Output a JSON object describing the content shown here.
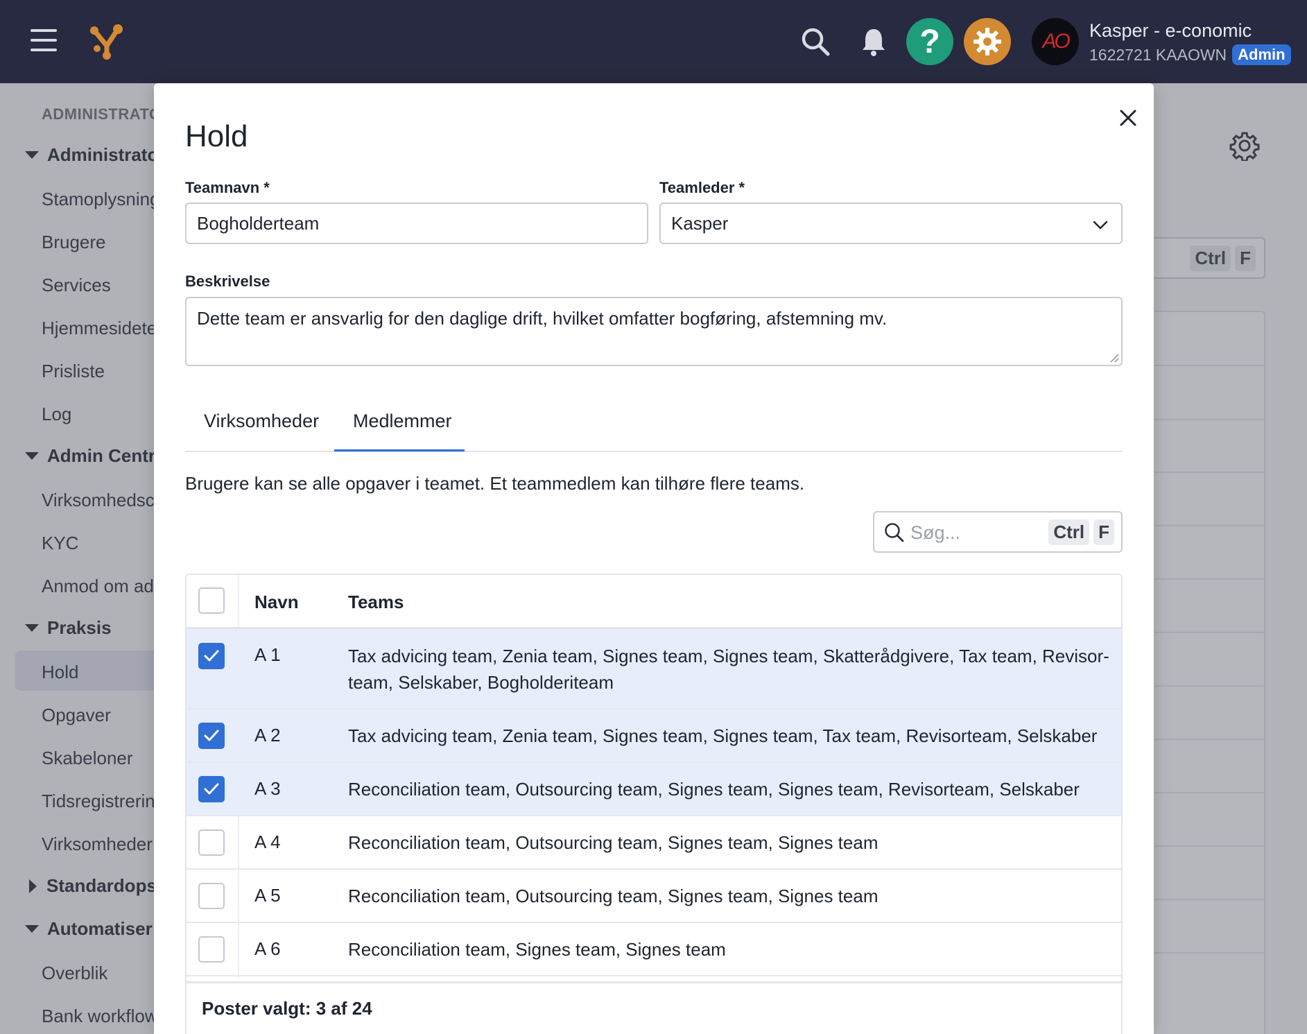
{
  "topbar": {
    "user_name": "Kasper - e-conomic",
    "user_account": "1622721 KAAOWN",
    "role_badge": "Admin",
    "avatar_text": "AO",
    "help_label": "?"
  },
  "sidebar": {
    "section_title": "ADMINISTRATO",
    "groups": [
      {
        "label": "Administrato",
        "items": [
          "Stamoplysning",
          "Brugere",
          "Services",
          "Hjemmesidete",
          "Prisliste",
          "Log"
        ]
      },
      {
        "label": "Admin Centr",
        "items": [
          "Virksomhedsc",
          "KYC",
          "Anmod om ad"
        ]
      },
      {
        "label": "Praksis",
        "items": [
          "Hold",
          "Opgaver",
          "Skabeloner",
          "Tidsregistrerin",
          "Virksomheder"
        ]
      },
      {
        "label": "Standardops",
        "items": []
      },
      {
        "label": "Automatiser",
        "items": [
          "Overblik",
          "Bank workflow"
        ]
      }
    ],
    "active_item": "Hold"
  },
  "background": {
    "kbd_ctrl": "Ctrl",
    "kbd_f": "F"
  },
  "modal": {
    "title": "Hold",
    "teamname_label": "Teamnavn *",
    "teamname_value": "Bogholderteam",
    "teamleader_label": "Teamleder *",
    "teamleader_value": "Kasper",
    "description_label": "Beskrivelse",
    "description_value": "Dette team er ansvarlig for den daglige drift, hvilket omfatter bogføring, afstemning mv.",
    "tabs": [
      {
        "label": "Virksomheder",
        "active": false
      },
      {
        "label": "Medlemmer",
        "active": true
      }
    ],
    "info_text": "Brugere kan se alle opgaver i teamet. Et teammedlem kan tilhøre flere teams.",
    "search": {
      "placeholder": "Søg...",
      "kbd_ctrl": "Ctrl",
      "kbd_f": "F"
    },
    "table": {
      "headers": {
        "name": "Navn",
        "teams": "Teams"
      },
      "rows": [
        {
          "name": "A 1",
          "teams": "Tax advicing team, Zenia team, Signes team, Signes team, Skatterådgivere, Tax team, Revisor-team, Selskaber, Bogholderiteam",
          "checked": true
        },
        {
          "name": "A 2",
          "teams": "Tax advicing team, Zenia team, Signes team, Signes team, Tax team, Revisorteam, Selskaber",
          "checked": true
        },
        {
          "name": "A 3",
          "teams": "Reconciliation team, Outsourcing team, Signes team, Signes team, Revisorteam, Selskaber",
          "checked": true
        },
        {
          "name": "A 4",
          "teams": "Reconciliation team, Outsourcing team, Signes team, Signes team",
          "checked": false
        },
        {
          "name": "A 5",
          "teams": "Reconciliation team, Outsourcing team, Signes team, Signes team",
          "checked": false
        },
        {
          "name": "A 6",
          "teams": "Reconciliation team, Signes team, Signes team",
          "checked": false
        }
      ],
      "footer": "Poster valgt: 3 af 24"
    }
  },
  "colors": {
    "topbar": "#272a40",
    "accent": "#2f6fd6",
    "help": "#1f9c7a",
    "settings": "#d48a32",
    "selected_row": "#e7edfb"
  }
}
